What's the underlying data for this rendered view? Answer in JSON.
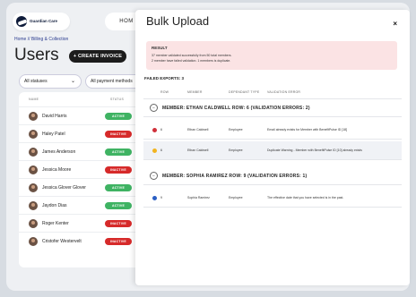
{
  "background": {
    "logo": {
      "name": "Guardian Care",
      "tagline": ""
    },
    "home_button": "HOM",
    "breadcrumb": "Home // Billing & Collection",
    "page_title": "Users",
    "create_button": "+ CREATE INVOICE",
    "filters": [
      {
        "label": "All statuses"
      },
      {
        "label": "All payment methods"
      }
    ],
    "table_headers": {
      "name": "NAME",
      "status": "STATUS"
    },
    "users": [
      {
        "name": "David Harris",
        "status": "ACTIVE"
      },
      {
        "name": "Haley Patel",
        "status": "INACTIVE"
      },
      {
        "name": "James Anderson",
        "status": "ACTIVE"
      },
      {
        "name": "Jessica Moore",
        "status": "INACTIVE"
      },
      {
        "name": "Jessica Glover Glover",
        "status": "ACTIVE"
      },
      {
        "name": "Jaydon Dias",
        "status": "ACTIVE"
      },
      {
        "name": "Roger Kenter",
        "status": "INACTIVE"
      },
      {
        "name": "Cristofer Westervelt",
        "status": "INACTIVE"
      }
    ],
    "pager_symbol": "<"
  },
  "modal": {
    "title": "Bulk Upload",
    "close_symbol": "×",
    "result": {
      "heading": "RESULT",
      "line1": "37 member validated successfully from 50 total members.",
      "line2": "2 member have failed validation. 1 members is duplicate."
    },
    "failed_exports": "FAILED EXPORTS: 3",
    "columns": {
      "row": "ROW",
      "member": "MEMBER",
      "dependant_type": "DEPENDANT TYPE",
      "validation_error": "VALIDATION ERROR"
    },
    "groups": [
      {
        "toggle": "−",
        "label": "MEMBER: ETHAN CALDWELL     ROW: 6     (VALIDATION ERRORS: 2)",
        "rows": [
          {
            "severity": "error",
            "row": "6",
            "member": "Ethan Caldwell",
            "dependant_type": "Employee",
            "error": "Email already exists for Member with BenefitPulse ID [18]"
          },
          {
            "severity": "warning",
            "row": "6",
            "member": "Ethan Caldwell",
            "dependant_type": "Employee",
            "error": "Duplicate Warning - Member with BenefitPulse ID [10] already exists"
          }
        ]
      },
      {
        "toggle": "−",
        "label": "MEMBER: SOPHIA RAMIREZ     ROW: 9     (VALIDATION ERRORS: 1)",
        "rows": [
          {
            "severity": "info",
            "row": "9",
            "member": "Sophia Ramirez",
            "dependant_type": "Employee",
            "error": "The effective date that you have selected is in the past."
          }
        ]
      }
    ]
  },
  "colors": {
    "active": "#3fb363",
    "inactive": "#d62a2a",
    "error": "#d0303a",
    "warning": "#f2b420",
    "info": "#2b5fc4",
    "brand_navy": "#0e1b3a"
  }
}
